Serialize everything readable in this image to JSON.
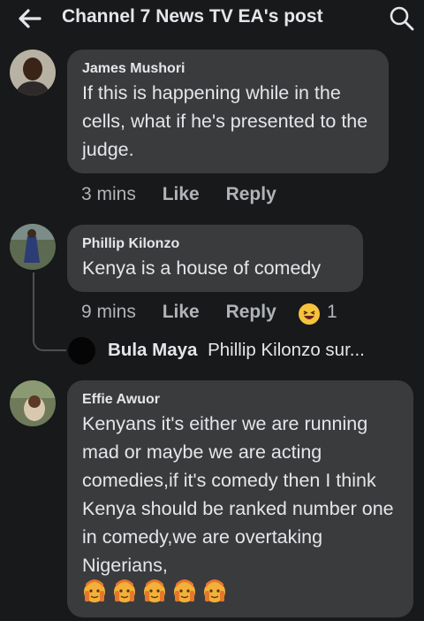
{
  "header": {
    "title": "Channel 7 News TV EA's post",
    "back_icon": "arrow-left-icon",
    "search_icon": "search-icon"
  },
  "comments": [
    {
      "author": "James Mushori",
      "text": "If this is happening while in the cells, what if he's presented to the judge.",
      "time": "3 mins",
      "like_label": "Like",
      "reply_label": "Reply"
    },
    {
      "author": "Phillip Kilonzo",
      "text": "Kenya is a house of comedy",
      "time": "9 mins",
      "like_label": "Like",
      "reply_label": "Reply",
      "reaction_icon": "laughing-emoji-icon",
      "reaction_count": "1",
      "reply_preview": {
        "author": "Bula Maya",
        "text": "Phillip Kilonzo sur..."
      }
    },
    {
      "author": "Effie Awuor",
      "text": "Kenyans it's either we are running mad or maybe we are acting comedies,if it's comedy then I think Kenya should be ranked number one in comedy,we are overtaking Nigerians,",
      "emoji_icon": "person-facepalming-emoji-icon"
    }
  ],
  "colors": {
    "background": "#18191a",
    "bubble": "#3a3b3c",
    "primary_text": "#e4e6eb",
    "secondary_text": "#b0b3b8"
  }
}
